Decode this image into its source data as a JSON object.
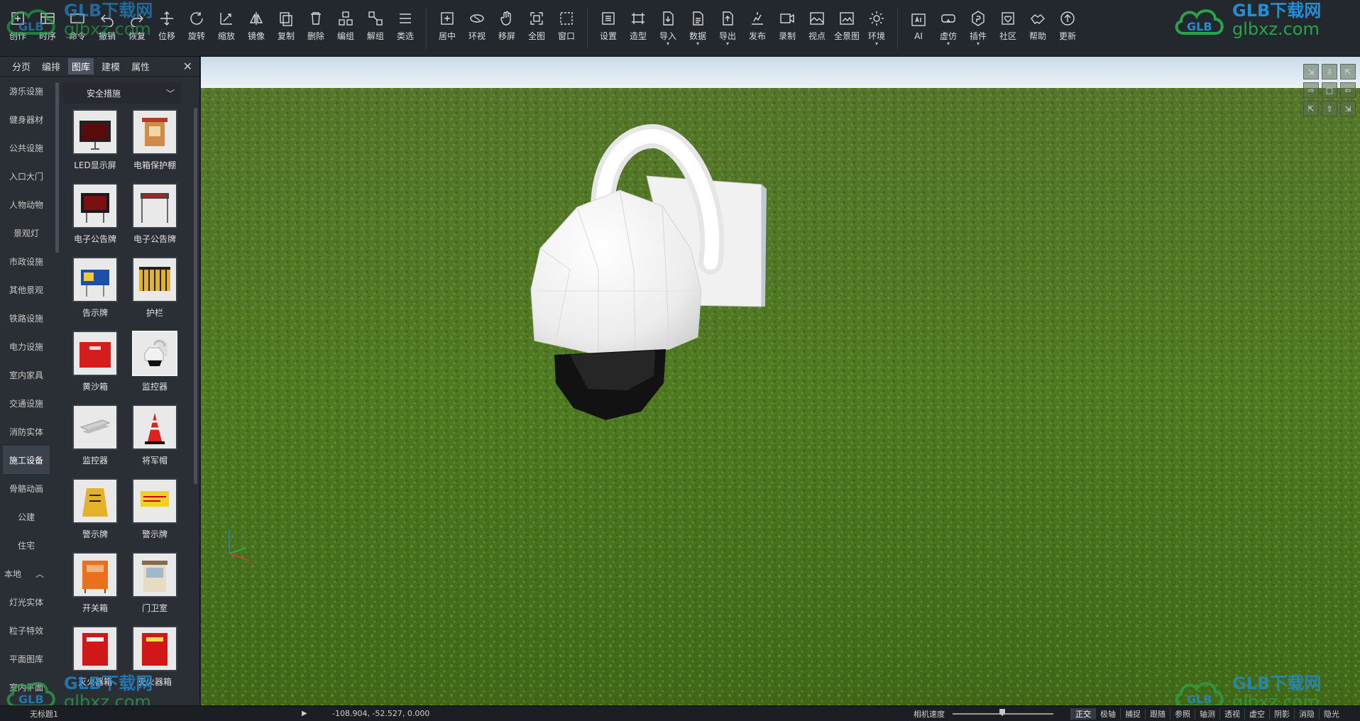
{
  "toolbar": {
    "buttons": [
      {
        "label": "创作",
        "icon": "create-icon"
      },
      {
        "label": "时序",
        "icon": "timeline-icon"
      },
      {
        "label": "命令",
        "icon": "command-icon"
      },
      {
        "label": "撤销",
        "icon": "undo-icon"
      },
      {
        "label": "恢复",
        "icon": "redo-icon"
      },
      {
        "label": "位移",
        "icon": "move-icon"
      },
      {
        "label": "旋转",
        "icon": "rotate-icon"
      },
      {
        "label": "缩放",
        "icon": "scale-icon"
      },
      {
        "label": "镜像",
        "icon": "mirror-icon"
      },
      {
        "label": "复制",
        "icon": "copy-icon"
      },
      {
        "label": "删除",
        "icon": "delete-icon"
      },
      {
        "label": "编组",
        "icon": "group-icon"
      },
      {
        "label": "解组",
        "icon": "ungroup-icon"
      },
      {
        "label": "类选",
        "icon": "select-similar-icon"
      },
      {
        "label": "居中",
        "icon": "center-icon"
      },
      {
        "label": "环视",
        "icon": "orbit-icon"
      },
      {
        "label": "移屏",
        "icon": "pan-icon"
      },
      {
        "label": "全图",
        "icon": "zoom-extents-icon"
      },
      {
        "label": "窗口",
        "icon": "zoom-window-icon"
      },
      {
        "label": "设置",
        "icon": "settings-icon"
      },
      {
        "label": "造型",
        "icon": "modeling-icon"
      },
      {
        "label": "导入",
        "icon": "import-icon",
        "caret": true
      },
      {
        "label": "数据",
        "icon": "data-icon",
        "caret": true
      },
      {
        "label": "导出",
        "icon": "export-icon",
        "caret": true
      },
      {
        "label": "发布",
        "icon": "publish-icon"
      },
      {
        "label": "录制",
        "icon": "record-icon"
      },
      {
        "label": "视点",
        "icon": "viewpoint-icon"
      },
      {
        "label": "全景图",
        "icon": "panorama-icon"
      },
      {
        "label": "环境",
        "icon": "environment-icon",
        "caret": true
      },
      {
        "label": "AI",
        "icon": "ai-icon"
      },
      {
        "label": "虚仿",
        "icon": "vr-icon",
        "caret": true
      },
      {
        "label": "插件",
        "icon": "plugin-icon",
        "caret": true
      },
      {
        "label": "社区",
        "icon": "community-icon"
      },
      {
        "label": "帮助",
        "icon": "help-icon"
      },
      {
        "label": "更新",
        "icon": "update-icon"
      }
    ]
  },
  "watermark": {
    "brand": "GLB下载网",
    "url": "glbxz.com"
  },
  "panel": {
    "tabs": [
      "分页",
      "编排",
      "图库",
      "建模",
      "属性"
    ],
    "active_tab": "图库",
    "close_label": "✕",
    "categories": [
      "游乐设施",
      "健身器材",
      "公共设施",
      "入口大门",
      "人物动物",
      "景观灯",
      "市政设施",
      "其他景观",
      "铁路设施",
      "电力设施",
      "室内家具",
      "交通设施",
      "消防实体",
      "施工设备",
      "骨骼动画",
      "公建",
      "住宅"
    ],
    "active_category": "施工设备",
    "section_label": "本地",
    "section_caret": "︿",
    "local_categories": [
      "灯光实体",
      "粒子特效",
      "平面图库",
      "室内平面"
    ],
    "dropdown_value": "安全措施",
    "dropdown_chevron": "﹀",
    "items": [
      {
        "name": "LED显示屏",
        "thumb": "led-screen"
      },
      {
        "name": "电箱保护棚",
        "thumb": "box-shelter"
      },
      {
        "name": "电子公告牌",
        "thumb": "e-board"
      },
      {
        "name": "电子公告牌",
        "thumb": "e-board-frame"
      },
      {
        "name": "告示牌",
        "thumb": "notice"
      },
      {
        "name": "护栏",
        "thumb": "fence"
      },
      {
        "name": "黄沙箱",
        "thumb": "sand-box"
      },
      {
        "name": "监控器",
        "thumb": "dome-camera"
      },
      {
        "name": "监控器",
        "thumb": "bullet-camera"
      },
      {
        "name": "将军帽",
        "thumb": "traffic-cone"
      },
      {
        "name": "警示牌",
        "thumb": "warning-stand"
      },
      {
        "name": "警示牌",
        "thumb": "warning-sign"
      },
      {
        "name": "开关箱",
        "thumb": "switch-box"
      },
      {
        "name": "门卫室",
        "thumb": "guard-booth"
      },
      {
        "name": "灭火器箱",
        "thumb": "extinguisher-box"
      },
      {
        "name": "灭火器箱",
        "thumb": "extinguisher-box-2"
      }
    ],
    "selected_index": 7
  },
  "viewcube": [
    "⇲",
    "⇩",
    "⇱",
    "⇨",
    "□",
    "⇦",
    "⇱",
    "⇧",
    "⇲"
  ],
  "status": {
    "doc_title": "无标题1",
    "play": "▶",
    "coords": "-108.904, -52.527, 0.000",
    "speed_label": "相机速度",
    "toggles": [
      "正交",
      "极轴",
      "捕捉",
      "跟随",
      "参照",
      "轴测",
      "透视",
      "虚空",
      "阴影",
      "消隐",
      "隐光"
    ],
    "toggles_on": [
      0
    ]
  },
  "colors": {
    "accent": "#1f8fd8",
    "brand_green": "#2aa34a",
    "grass": "#4e7a22",
    "sky": "#dbe8f2"
  }
}
